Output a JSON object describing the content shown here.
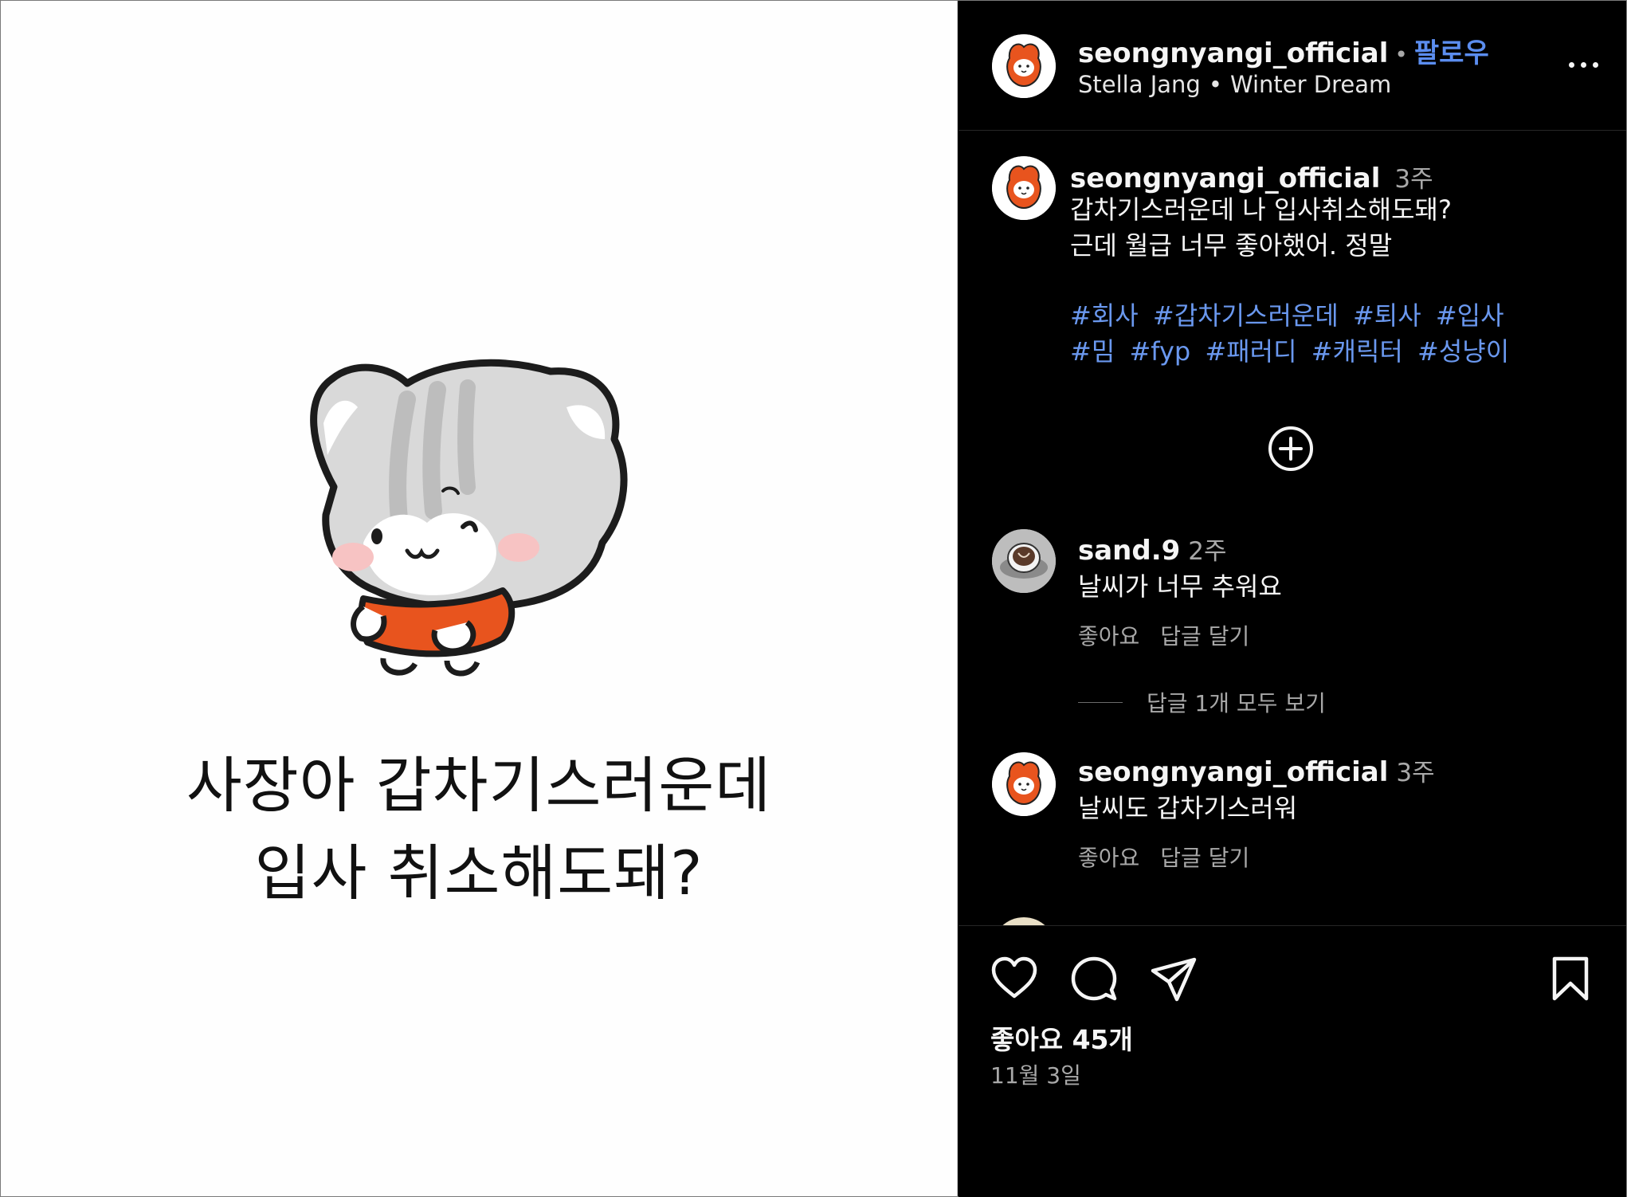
{
  "post": {
    "image_caption_lines": [
      "사장아 갑차기스러운데",
      "입사 취소해도돼?"
    ]
  },
  "header": {
    "username": "seongnyangi_official",
    "dot": "•",
    "follow_label": "팔로우",
    "audio_artist": "Stella Jang",
    "audio_sep": "•",
    "audio_title": "Winter Dream"
  },
  "caption": {
    "username": "seongnyangi_official",
    "time": "3주",
    "lines": [
      "갑차기스러운데 나 입사취소해도돼?",
      "근데 월급 너무 좋아했어. 정말"
    ],
    "hashtags": [
      "#회사",
      "#갑차기스러운데",
      "#퇴사",
      "#입사",
      "#밈",
      "#fyp",
      "#패러디",
      "#캐릭터",
      "#성냥이"
    ]
  },
  "comments": [
    {
      "username": "sand.9",
      "time": "2주",
      "text": "날씨가 너무 추워요",
      "like_label": "좋아요",
      "reply_label": "답글 달기"
    },
    {
      "username": "seongnyangi_official",
      "time": "3주",
      "text": "날씨도 갑차기스러워",
      "like_label": "좋아요",
      "reply_label": "답글 달기"
    }
  ],
  "view_replies_label": "답글 1개 모두 보기",
  "footer": {
    "likes": "좋아요 45개",
    "date": "11월 3일"
  },
  "colors": {
    "accent_link": "#6a98ef",
    "follow_blue": "#5b8def",
    "cat_dress": "#e8541e"
  },
  "icons": [
    "more-icon",
    "add-circle-icon",
    "heart-icon",
    "comment-icon",
    "share-icon",
    "bookmark-icon"
  ]
}
